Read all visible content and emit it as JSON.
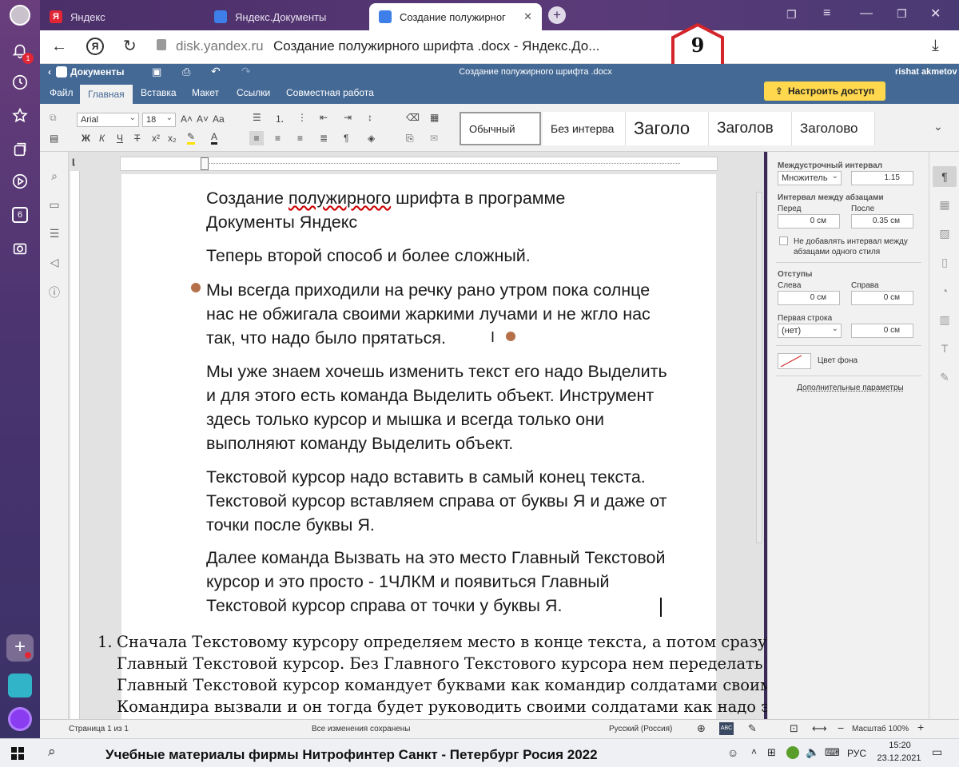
{
  "tabs": [
    {
      "label": "Яндекс",
      "icon": "yandex-icon",
      "color": "#e32636"
    },
    {
      "label": "Яндекс.Документы",
      "icon": "docs-icon",
      "color": "#3d7ee8"
    },
    {
      "label": "Создание полужирног",
      "icon": "docs-icon",
      "color": "#3d7ee8"
    }
  ],
  "address": {
    "domain": "disk.yandex.ru",
    "title": "Создание полужирного шрифта .docx - Яндекс.До..."
  },
  "step_badge": "9",
  "rail": {
    "notification_count": "1",
    "tab_count": "6"
  },
  "editor": {
    "back_label": "Документы",
    "doc_title": "Создание полужирного шрифта .docx",
    "user": "rishat akmetov",
    "share_label": "Настроить доступ",
    "menu_tabs": [
      "Файл",
      "Главная",
      "Вставка",
      "Макет",
      "Ссылки",
      "Совместная работа"
    ],
    "font_name": "Arial",
    "font_size": "18",
    "styles": [
      "Обычный",
      "Без интерва",
      "Заголо",
      "Заголов",
      "Заголово"
    ]
  },
  "document": {
    "paragraphs": [
      "Создание полужирного шрифта в программе Документы Яндекс",
      "Теперь второй способ и более сложный.",
      "Мы всегда приходили на речку рано утром пока солнце нас не обжигала своими жаркими лучами и не жгло нас так, что надо было прятаться.",
      "Мы уже знаем хочешь изменить текст его надо Выделить и для этого есть команда Выделить объект. Инструмент здесь только курсор и мышка и всегда только они выполняют команду Выделить объект.",
      "Текстовой курсор надо вставить в самый конец текста. Текстовой курсор вставляем справа от буквы Я и даже от точки после буквы Я.",
      "Далее команда Вызвать на это место Главный Текстовой курсор и это просто - 1ЧЛКМ и появиться Главный Текстовой курсор справа от точки у буквы Я."
    ],
    "title_pre": "Создание ",
    "title_underlined": "полужирного",
    "title_post": " шрифта в программе",
    "title_line2": "Документы Яндекс"
  },
  "panel": {
    "line_spacing_label": "Междустрочный интервал",
    "line_spacing_mode": "Множитель",
    "line_spacing_value": "1.15",
    "para_spacing_label": "Интервал между абзацами",
    "before_label": "Перед",
    "after_label": "После",
    "before_value": "0 см",
    "after_value": "0.35 см",
    "no_interval_label": "Не добавлять интервал между абзацами одного стиля",
    "indents_label": "Отступы",
    "left_label": "Слева",
    "right_label": "Справа",
    "left_value": "0 см",
    "right_value": "0 см",
    "first_line_label": "Первая строка",
    "first_line_mode": "(нет)",
    "first_line_value": "0 см",
    "bg_color_label": "Цвет фона",
    "more_params_label": "Дополнительные параметры"
  },
  "overlay_list": {
    "number": "1.",
    "lines": [
      "Сначала Текстовому курсору определяем место в конце текста, а потом сразу сода вставляем сам",
      "Главный Текстовой курсор. Без Главного Текстового курсора нем переделать текст ни кто не даст.",
      "Главный Текстовой курсор командует буквами как командир солдатами своими в армии.",
      "Командира вызвали и он тогда будет руководить своими солдатами как надо это делать."
    ]
  },
  "status": {
    "page": "Страница 1 из 1",
    "saved": "Все изменения сохранены",
    "language": "Русский (Россия)",
    "zoom": "Масштаб 100%"
  },
  "taskbar": {
    "caption": "Учебные материалы фирмы Нитрофинтер Санкт - Петербург Росия 2022",
    "lang": "РУС",
    "time": "15:20",
    "date": "23.12.2021"
  },
  "colors": {
    "editor_blue": "#446995",
    "share_yellow": "#ffd84d",
    "badge_red": "#d3252a"
  }
}
